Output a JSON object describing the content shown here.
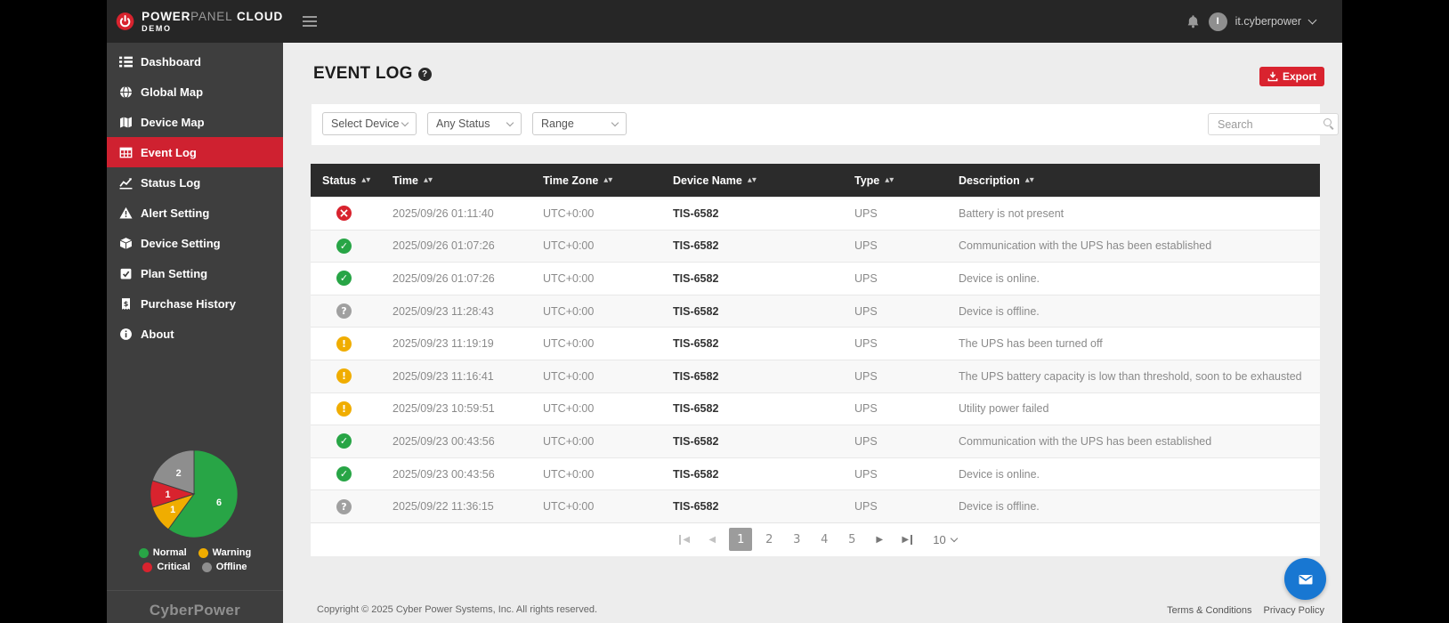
{
  "topbar": {
    "brand": {
      "bold1": "POWER",
      "light": "PANEL",
      "bold2": "CLOUD",
      "line2": "DEMO"
    },
    "user": {
      "name": "it.cyberpower",
      "avatar_initial": "I"
    }
  },
  "sidebar": {
    "items": [
      {
        "label": "Dashboard"
      },
      {
        "label": "Global Map"
      },
      {
        "label": "Device Map"
      },
      {
        "label": "Event Log",
        "active": true
      },
      {
        "label": "Status Log"
      },
      {
        "label": "Alert Setting"
      },
      {
        "label": "Device Setting"
      },
      {
        "label": "Plan Setting"
      },
      {
        "label": "Purchase History"
      },
      {
        "label": "About"
      }
    ],
    "legend": [
      {
        "label": "Normal",
        "color": "#28a546"
      },
      {
        "label": "Warning",
        "color": "#f0ad00"
      },
      {
        "label": "Critical",
        "color": "#d8232e"
      },
      {
        "label": "Offline",
        "color": "#8e8e8e"
      }
    ],
    "logo_text": "CyberPower"
  },
  "chart_data": {
    "type": "pie",
    "slices": [
      {
        "label": "Normal",
        "value": 6,
        "color": "#28a546"
      },
      {
        "label": "Warning",
        "value": 1,
        "color": "#f0ad00"
      },
      {
        "label": "Critical",
        "value": 1,
        "color": "#d8232e"
      },
      {
        "label": "Offline",
        "value": 2,
        "color": "#8e8e8e"
      }
    ],
    "legend_position": "bottom"
  },
  "page": {
    "title": "EVENT LOG",
    "export_label": "Export",
    "filters": {
      "device": "Select Device",
      "status": "Any Status",
      "range": "Range"
    },
    "search_placeholder": "Search"
  },
  "table": {
    "columns": [
      "Status",
      "Time",
      "Time Zone",
      "Device Name",
      "Type",
      "Description"
    ],
    "rows": [
      {
        "status": "critical",
        "time": "2025/09/26 01:11:40",
        "timezone": "UTC+0:00",
        "device": "TIS-6582",
        "type": "UPS",
        "description": "Battery is not present"
      },
      {
        "status": "normal",
        "time": "2025/09/26 01:07:26",
        "timezone": "UTC+0:00",
        "device": "TIS-6582",
        "type": "UPS",
        "description": "Communication with the UPS has been established"
      },
      {
        "status": "normal",
        "time": "2025/09/26 01:07:26",
        "timezone": "UTC+0:00",
        "device": "TIS-6582",
        "type": "UPS",
        "description": "Device is online."
      },
      {
        "status": "offline",
        "time": "2025/09/23 11:28:43",
        "timezone": "UTC+0:00",
        "device": "TIS-6582",
        "type": "UPS",
        "description": "Device is offline."
      },
      {
        "status": "warning",
        "time": "2025/09/23 11:19:19",
        "timezone": "UTC+0:00",
        "device": "TIS-6582",
        "type": "UPS",
        "description": "The UPS has been turned off"
      },
      {
        "status": "warning",
        "time": "2025/09/23 11:16:41",
        "timezone": "UTC+0:00",
        "device": "TIS-6582",
        "type": "UPS",
        "description": "The UPS battery capacity is low than threshold, soon to be exhausted"
      },
      {
        "status": "warning",
        "time": "2025/09/23 10:59:51",
        "timezone": "UTC+0:00",
        "device": "TIS-6582",
        "type": "UPS",
        "description": "Utility power failed"
      },
      {
        "status": "normal",
        "time": "2025/09/23 00:43:56",
        "timezone": "UTC+0:00",
        "device": "TIS-6582",
        "type": "UPS",
        "description": "Communication with the UPS has been established"
      },
      {
        "status": "normal",
        "time": "2025/09/23 00:43:56",
        "timezone": "UTC+0:00",
        "device": "TIS-6582",
        "type": "UPS",
        "description": "Device is online."
      },
      {
        "status": "offline",
        "time": "2025/09/22 11:36:15",
        "timezone": "UTC+0:00",
        "device": "TIS-6582",
        "type": "UPS",
        "description": "Device is offline."
      }
    ]
  },
  "pagination": {
    "pages": [
      "1",
      "2",
      "3",
      "4",
      "5"
    ],
    "active_page": "1",
    "page_size": "10"
  },
  "footer": {
    "copyright": "Copyright © 2025 Cyber Power Systems, Inc. All rights reserved.",
    "terms": "Terms & Conditions",
    "privacy": "Privacy Policy"
  }
}
